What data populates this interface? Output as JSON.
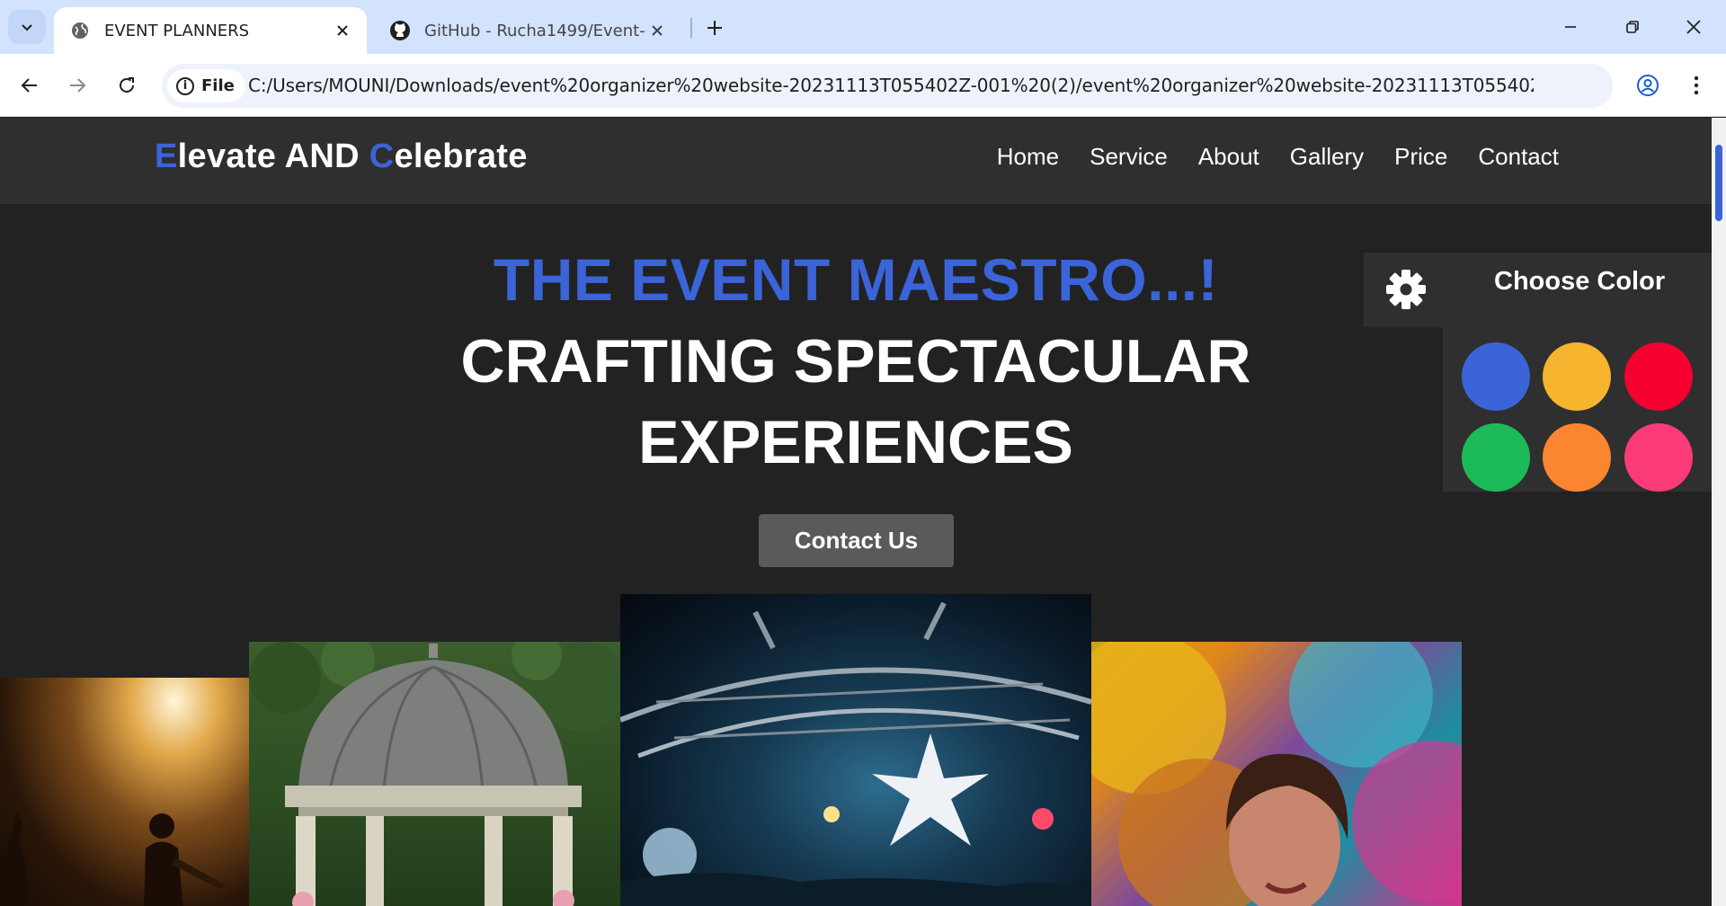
{
  "browser": {
    "tabs": [
      {
        "title": "EVENT PLANNERS",
        "icon": "globe-icon",
        "active": true
      },
      {
        "title": "GitHub - Rucha1499/Event-mar",
        "icon": "github-icon",
        "active": false
      }
    ],
    "address": {
      "chip_label": "File",
      "url": "C:/Users/MOUNI/Downloads/event%20organizer%20website-20231113T055402Z-001%20(2)/event%20organizer%20website-20231113T055402Z-001/eve..."
    }
  },
  "site": {
    "logo": {
      "part1_accent": "E",
      "part1_rest": "levate AND ",
      "part2_accent": "C",
      "part2_rest": "elebrate"
    },
    "nav": [
      "Home",
      "Service",
      "About",
      "Gallery",
      "Price",
      "Contact"
    ],
    "accent_color": "#3a64d8"
  },
  "hero": {
    "eyebrow": "THE EVENT MAESTRO...!",
    "title": "CRAFTING SPECTACULAR EXPERIENCES",
    "cta": "Contact Us"
  },
  "color_panel": {
    "title": "Choose Color",
    "swatches": [
      "#3a64d8",
      "#f6b42f",
      "#f5002f",
      "#1dba5a",
      "#fc8531",
      "#fa3b77"
    ]
  },
  "gallery": [
    {
      "name": "photo-concert"
    },
    {
      "name": "photo-gazebo"
    },
    {
      "name": "photo-stage"
    },
    {
      "name": "photo-colors"
    }
  ]
}
